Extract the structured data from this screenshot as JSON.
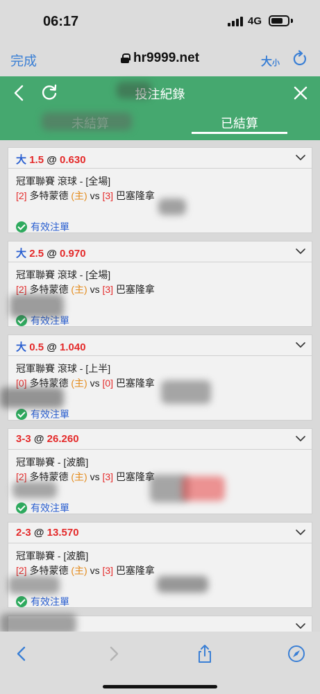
{
  "status_bar": {
    "time": "06:17",
    "network": "4G"
  },
  "browser": {
    "done_label": "完成",
    "url": "hr9999.net",
    "text_size_big": "大",
    "text_size_small": "小"
  },
  "header": {
    "title": "投注紀錄",
    "tabs": [
      {
        "label": "未結算",
        "active": false
      },
      {
        "label": "已結算",
        "active": true
      }
    ]
  },
  "bets": [
    {
      "selection": "大",
      "selection_color": "blue",
      "line": "1.5",
      "at": "@",
      "odds": "0.630",
      "league": "冠軍聯賽 滾球 - [全場]",
      "home_score": "[2]",
      "home_team": "多特蒙德",
      "home_tag": "(主)",
      "vs": "vs",
      "away_score": "[3]",
      "away_team": "巴塞隆拿",
      "status": "有效注單"
    },
    {
      "selection": "大",
      "selection_color": "blue",
      "line": "2.5",
      "at": "@",
      "odds": "0.970",
      "league": "冠軍聯賽 滾球 - [全場]",
      "home_score": "[2]",
      "home_team": "多特蒙德",
      "home_tag": "(主)",
      "vs": "vs",
      "away_score": "[3]",
      "away_team": "巴塞隆拿",
      "status": "有效注單"
    },
    {
      "selection": "大",
      "selection_color": "blue",
      "line": "0.5",
      "at": "@",
      "odds": "1.040",
      "league": "冠軍聯賽 滾球 - [上半]",
      "home_score": "[0]",
      "home_team": "多特蒙德",
      "home_tag": "(主)",
      "vs": "vs",
      "away_score": "[0]",
      "away_team": "巴塞隆拿",
      "status": "有效注單"
    },
    {
      "selection": "3-3",
      "selection_color": "red",
      "line": "",
      "at": "@",
      "odds": "26.260",
      "league": "冠軍聯賽 - [波膽]",
      "home_score": "[2]",
      "home_team": "多特蒙德",
      "home_tag": "(主)",
      "vs": "vs",
      "away_score": "[3]",
      "away_team": "巴塞隆拿",
      "status": "有效注單"
    },
    {
      "selection": "2-3",
      "selection_color": "red",
      "line": "",
      "at": "@",
      "odds": "13.570",
      "league": "冠軍聯賽 - [波膽]",
      "home_score": "[2]",
      "home_team": "多特蒙德",
      "home_tag": "(主)",
      "vs": "vs",
      "away_score": "[3]",
      "away_team": "巴塞隆拿",
      "status": "有效注單"
    }
  ],
  "icons": {
    "accent": "#3a7fd5",
    "header_green": "#45a86f",
    "valid_check": "#2eaa5e"
  }
}
